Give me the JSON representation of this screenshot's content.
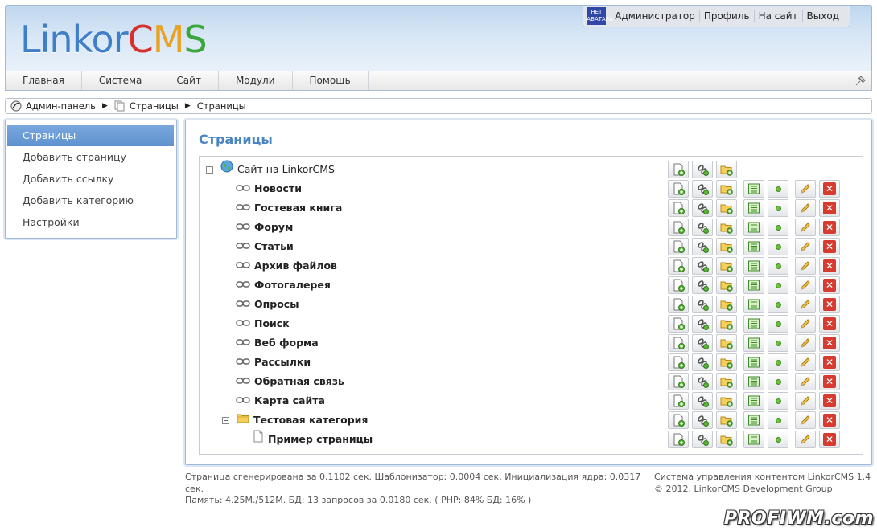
{
  "header": {
    "logo": {
      "part1": "Linkor",
      "part2": "C",
      "part3": "M",
      "part4": "S"
    },
    "avatar_text": "НЕТ АВАТАРА",
    "user_menu": [
      "Администратор",
      "Профиль",
      "На сайт",
      "Выход"
    ]
  },
  "nav": {
    "items": [
      "Главная",
      "Система",
      "Сайт",
      "Модули",
      "Помощь"
    ]
  },
  "breadcrumb": {
    "items": [
      "Админ-панель",
      "Страницы",
      "Страницы"
    ]
  },
  "sidebar": {
    "items": [
      "Страницы",
      "Добавить страницу",
      "Добавить ссылку",
      "Добавить категорию",
      "Настройки"
    ],
    "active_index": 0
  },
  "main": {
    "title": "Страницы",
    "tree": {
      "root": "Сайт на LinkorCMS",
      "links": [
        "Новости",
        "Гостевая книга",
        "Форум",
        "Статьи",
        "Архив файлов",
        "Фотогалерея",
        "Опросы",
        "Поиск",
        "Веб форма",
        "Рассылки",
        "Обратная связь",
        "Карта сайта"
      ],
      "category": "Тестовая категория",
      "page": "Пример страницы"
    }
  },
  "footer": {
    "left_line1": "Страница сгенерирована за 0.1102 сек. Шаблонизатор: 0.0004 сек. Инициализация ядра: 0.0317 сек.",
    "left_line2": "Память: 4.25M./512M. БД: 13 запросов за 0.0180 сек. ( PHP: 84% БД: 16% )",
    "right_line1": "Система управления контентом LinkorCMS 1.4",
    "right_line2": "© 2012, LinkorCMS Development Group"
  },
  "watermark": "PROFIWM.com",
  "colors": {
    "accent": "#4a85bd",
    "active_sidebar": "#6a9bd5",
    "delete": "#d73a2f",
    "status_green": "#6cc13c"
  }
}
